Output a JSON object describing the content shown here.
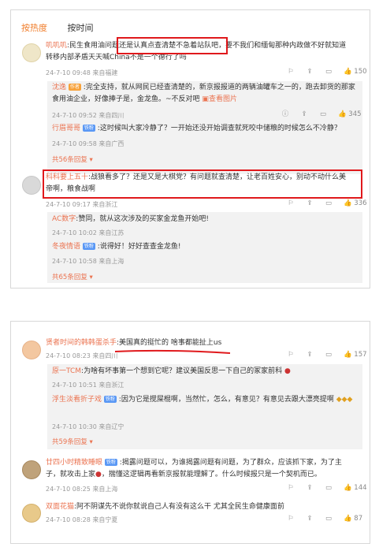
{
  "tabs": {
    "hot": "按热度",
    "time": "按时间"
  },
  "c1": {
    "name": "叽叽叽",
    "text_a": ":民生食用油问题",
    "text_b": "还是认真点查清楚不急着站队吧",
    "text_c": "，要不我们和缅甸那种内政做不好就知道",
    "text_d": "转移内部矛盾天天喊China不是一个德行了吗",
    "meta": "24-7-10 09:48 来自福建",
    "likes": "150"
  },
  "c1r1": {
    "name": "沈逸",
    "badge": "作者",
    "text": ":完全支持，就从网民已经查清楚的，新京报报道的两辆油罐车之一的，跑去卸货的那家食用油企业，好像捧子是，金龙鱼。~不反对吧",
    "link": "查看图片",
    "meta": "24-7-10 09:52 来自四川",
    "likes": "345"
  },
  "c1r2": {
    "name": "行眉哥哥",
    "badge": "铁粉",
    "text": ":这时候叫大家冷静了？一开始还没开始调查就死咬中储粮的时候怎么不冷静？",
    "meta": "24-7-10 09:58 来自广西"
  },
  "c1more": "共56条回复",
  "c2": {
    "name": "科科要上五十",
    "text_a": ":战狼看多了？还是又是大棋党？有问题就查清楚，让老百姓安心，别动不动什么美",
    "text_b": "帝啊，粮食战啊",
    "meta": "24-7-10 09:17 来自浙江",
    "likes": "336"
  },
  "c2r1": {
    "name": "AC数字",
    "text": ":赞同，就从这次涉及的买家金龙鱼开始吧!",
    "meta": "24-7-10 10:02 来自江苏"
  },
  "c2r2": {
    "name": "冬夜情语",
    "badge": "铁粉",
    "text": ":说得好！好好查查金龙鱼!",
    "meta": "24-7-10 10:58 来自上海"
  },
  "c2more": "共65条回复",
  "c3": {
    "name": "贤者时间的韩韩蛋杀手",
    "text_a": ":美国真的挺忙的",
    "text_b": " 啥事都能扯上us",
    "meta": "24-7-10 08:23 来自四川",
    "likes": "157"
  },
  "c3r1": {
    "name": "原一TCM",
    "text": ":为啥有坏事第一个想到它呢？建议美国反思一下自己的冢家前科",
    "meta": "24-7-10 10:51 来自浙江"
  },
  "c3r2": {
    "name": "浮生淡看折子戏",
    "badge": "铁粉",
    "text": ":因为它是搅屎棍啊，当然忙，怎么，有意见？有意见去跟大漂亮提啊",
    "meta": "24-7-10 10:30 来自辽宁"
  },
  "c3more": "共59条回复",
  "c4": {
    "name": "廿四小时精致睡眼",
    "badge": "铁粉",
    "text_a": ":揭露问题可以，为谁揭露问题有问题，为了群众，应该抓下家，为了主",
    "text_b": "子，就攻击上家",
    "text_c": "，揣懂这逻辑再看新京报就能理解了。什么时候报只是一个契机而已。",
    "meta": "24-7-10 08:25 来自上海",
    "likes": "144"
  },
  "c5": {
    "name": "双面花猫",
    "text": ":阿不阴谋先不说你就说自己人有没有这么干 尤其全民生命健康面前",
    "meta": "24-7-10 08:28 来自宁夏",
    "likes": "87"
  },
  "colors": {
    "accent": "#eb7350",
    "tab_active": "#f07e2c",
    "highlight": "#e0191c"
  }
}
